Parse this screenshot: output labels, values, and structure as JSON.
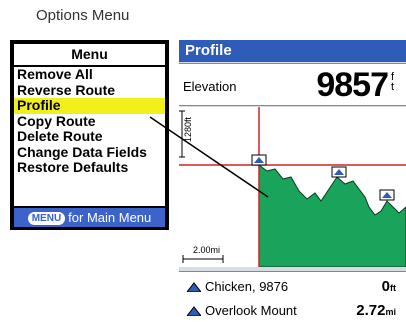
{
  "caption": "Options Menu",
  "menu": {
    "title": "Menu",
    "items": [
      {
        "label": "Remove All",
        "selected": false
      },
      {
        "label": "Reverse Route",
        "selected": false
      },
      {
        "label": "Profile",
        "selected": true
      },
      {
        "label": "Copy Route",
        "selected": false
      },
      {
        "label": "Delete Route",
        "selected": false
      },
      {
        "label": "Change Data Fields",
        "selected": false
      },
      {
        "label": "Restore Defaults",
        "selected": false
      }
    ],
    "footer_button": "MENU",
    "footer_text": "for Main Menu"
  },
  "profile": {
    "title": "Profile",
    "elevation_label": "Elevation",
    "elevation_value": "9857",
    "elevation_unit_top": "f",
    "elevation_unit_bottom": "t",
    "scale_label": "1280ft",
    "distance_scale": "2.00mi",
    "waypoints": [
      {
        "name": "Chicken, 9876",
        "distance": "0",
        "unit": "ft"
      },
      {
        "name": "Overlook Mount",
        "distance": "2.72",
        "unit": "mi"
      }
    ]
  },
  "colors": {
    "title_bar": "#2e5cb8",
    "profile_fill": "#1aa35a",
    "cursor_line": "#d62020",
    "selection": "#f3ef1a"
  }
}
